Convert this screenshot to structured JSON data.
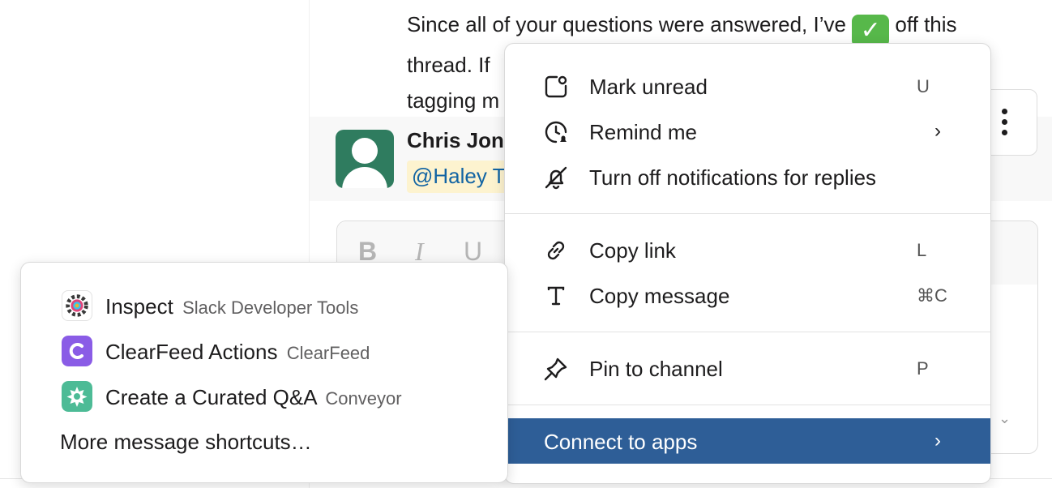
{
  "message": {
    "line1": "Since all of your questions were answered, I’ve",
    "emoji": "✓",
    "line1_tail": "off this",
    "line2": "thread. If",
    "line3": "tagging m"
  },
  "reply": {
    "author": "Chris Jon",
    "mention": "@Haley T"
  },
  "composer": {
    "bold": "B",
    "italic": "I",
    "underline": "U"
  },
  "context_menu": {
    "items": [
      {
        "label": "Mark unread",
        "shortcut": "U",
        "icon": "mark-unread-icon"
      },
      {
        "label": "Remind me",
        "arrow": "›",
        "icon": "clock-icon"
      },
      {
        "label": "Turn off notifications for replies",
        "icon": "bell-off-icon"
      },
      {
        "label": "Copy link",
        "shortcut": "L",
        "icon": "link-icon"
      },
      {
        "label": "Copy message",
        "shortcut": "⌘C",
        "icon": "text-icon"
      },
      {
        "label": "Pin to channel",
        "shortcut": "P",
        "icon": "pin-icon"
      },
      {
        "label": "Connect to apps",
        "arrow": "›"
      }
    ],
    "highlight_color": "#2e5e97"
  },
  "apps_submenu": {
    "items": [
      {
        "name": "Inspect",
        "provider": "Slack Developer Tools",
        "icon": "gear-icon"
      },
      {
        "name": "ClearFeed Actions",
        "provider": "ClearFeed",
        "icon": "clearfeed-icon",
        "color": "#8a5ce6"
      },
      {
        "name": "Create a Curated Q&A",
        "provider": "Conveyor",
        "icon": "conveyor-icon",
        "color": "#4dbb96"
      }
    ],
    "more": "More message shortcuts…"
  }
}
